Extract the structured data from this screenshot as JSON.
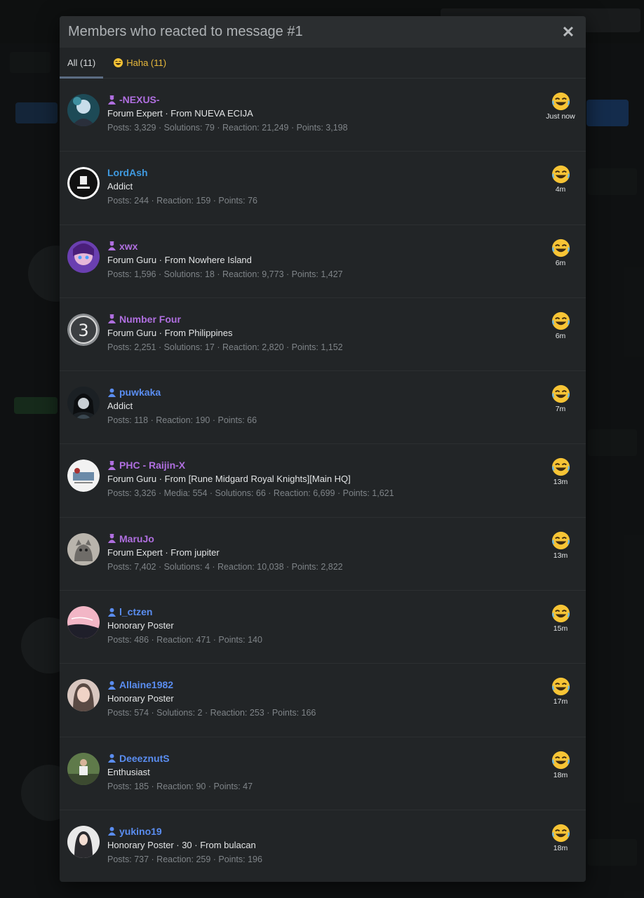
{
  "modal": {
    "title": "Members who reacted to message #1",
    "close_label": "✕"
  },
  "tabs": [
    {
      "label": "All (11)"
    },
    {
      "label": "Haha (11)"
    }
  ],
  "colors": {
    "staff_name": "#b06fe0",
    "member_name": "#5a8df0",
    "plain_name": "#3f9ae0",
    "haha": "#e8b93b"
  },
  "members": [
    {
      "name": "-NEXUS-",
      "badge": "staff-icon",
      "title": "Forum Expert · From NUEVA ECIJA",
      "stats": "Posts: 3,329 · Solutions: 79 · Reaction: 21,249 · Points: 3,198",
      "time": "Just now",
      "reaction_icon": "haha-emoji-icon"
    },
    {
      "name": "LordAsh",
      "badge": "",
      "title": "Addict",
      "stats": "Posts: 244 · Reaction: 159 · Points: 76",
      "time": "4m",
      "reaction_icon": "haha-emoji-icon"
    },
    {
      "name": "xwx",
      "badge": "staff-icon",
      "title": "Forum Guru · From Nowhere Island",
      "stats": "Posts: 1,596 · Solutions: 18 · Reaction: 9,773 · Points: 1,427",
      "time": "6m",
      "reaction_icon": "haha-emoji-icon"
    },
    {
      "name": "Number Four",
      "badge": "staff-icon",
      "title": "Forum Guru · From Philippines",
      "stats": "Posts: 2,251 · Solutions: 17 · Reaction: 2,820 · Points: 1,152",
      "time": "6m",
      "reaction_icon": "haha-emoji-icon"
    },
    {
      "name": "puwkaka",
      "badge": "member-icon",
      "title": "Addict",
      "stats": "Posts: 118 · Reaction: 190 · Points: 66",
      "time": "7m",
      "reaction_icon": "haha-emoji-icon"
    },
    {
      "name": "PHC - Raijin-X",
      "badge": "staff-icon",
      "title": "Forum Guru · From [Rune Midgard Royal Knights][Main HQ]",
      "stats": "Posts: 3,326 · Media: 554 · Solutions: 66 · Reaction: 6,699 · Points: 1,621",
      "time": "13m",
      "reaction_icon": "haha-emoji-icon"
    },
    {
      "name": "MaruJo",
      "badge": "staff-icon",
      "title": "Forum Expert · From jupiter",
      "stats": "Posts: 7,402 · Solutions: 4 · Reaction: 10,038 · Points: 2,822",
      "time": "13m",
      "reaction_icon": "haha-emoji-icon"
    },
    {
      "name": "l_ctzen",
      "badge": "member-icon",
      "title": "Honorary Poster",
      "stats": "Posts: 486 · Reaction: 471 · Points: 140",
      "time": "15m",
      "reaction_icon": "haha-emoji-icon"
    },
    {
      "name": "Allaine1982",
      "badge": "member-icon",
      "title": "Honorary Poster",
      "stats": "Posts: 574 · Solutions: 2 · Reaction: 253 · Points: 166",
      "time": "17m",
      "reaction_icon": "haha-emoji-icon"
    },
    {
      "name": "DeeeznutS",
      "badge": "member-icon",
      "title": "Enthusiast",
      "stats": "Posts: 185 · Reaction: 90 · Points: 47",
      "time": "18m",
      "reaction_icon": "haha-emoji-icon"
    },
    {
      "name": "yukino19",
      "badge": "member-icon",
      "title": "Honorary Poster · 30 · From bulacan",
      "stats": "Posts: 737 · Reaction: 259 · Points: 196",
      "time": "18m",
      "reaction_icon": "haha-emoji-icon"
    }
  ]
}
